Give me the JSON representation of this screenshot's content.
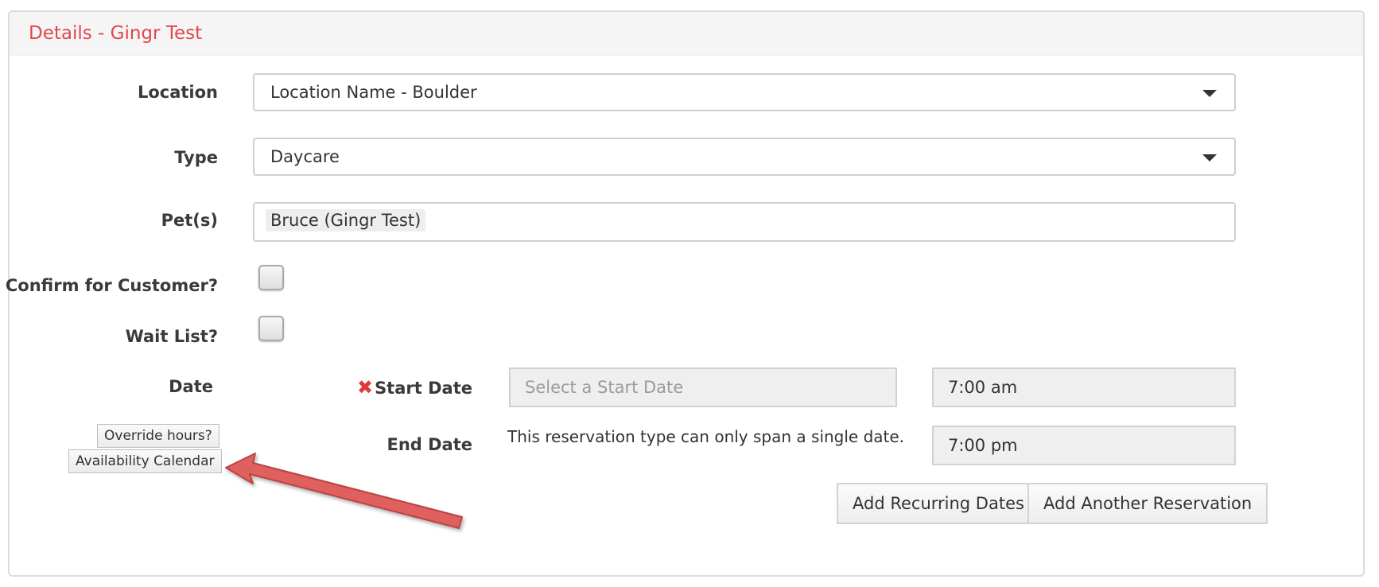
{
  "panel": {
    "title": "Details - Gingr Test"
  },
  "form": {
    "location": {
      "label": "Location",
      "value": "Location Name - Boulder"
    },
    "type": {
      "label": "Type",
      "value": "Daycare"
    },
    "pets": {
      "label": "Pet(s)",
      "tag": "Bruce (Gingr Test)"
    },
    "confirm": {
      "label": "Confirm for Customer?"
    },
    "waitlist": {
      "label": "Wait List?"
    },
    "date": {
      "label": "Date",
      "override_button": "Override hours?",
      "availability_button": "Availability Calendar",
      "start_label": "Start Date",
      "start_required_mark": "✖",
      "start_placeholder": "Select a Start Date",
      "start_time": "7:00 am",
      "end_label": "End Date",
      "end_note": "This reservation type can only span a single date.",
      "end_time": "7:00 pm"
    },
    "actions": {
      "recurring": "Add Recurring Dates",
      "another": "Add Another Reservation"
    }
  },
  "colors": {
    "accent": "#e2474c",
    "arrow": "#e0605e"
  }
}
